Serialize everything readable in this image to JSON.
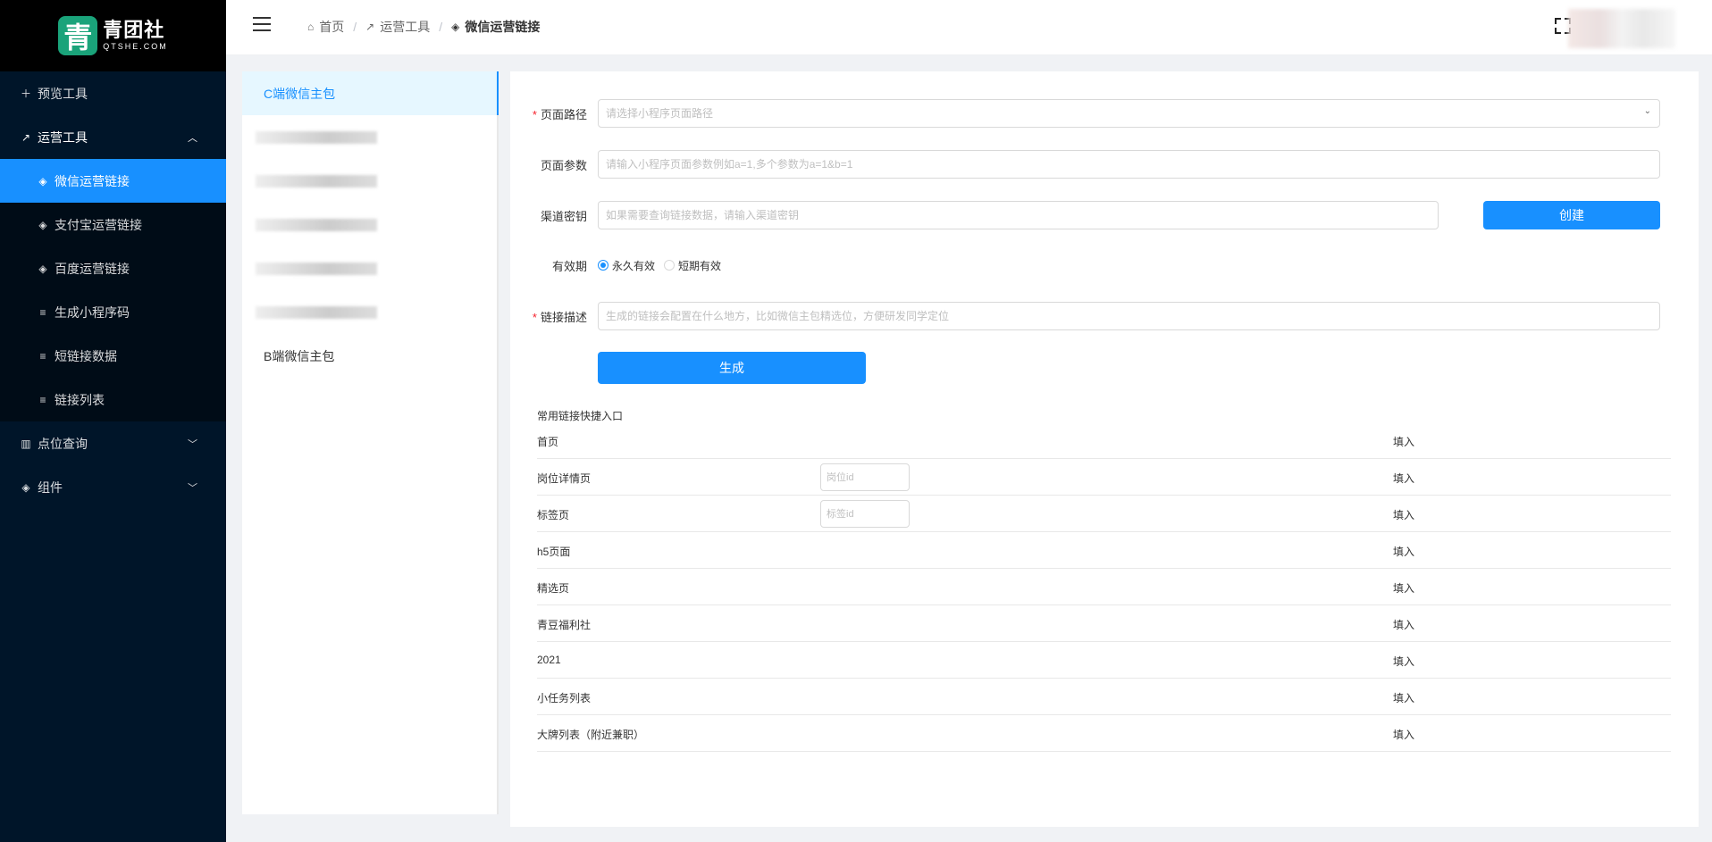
{
  "logo": {
    "glyph": "青",
    "name": "青团社",
    "domain": "QTSHE.COM"
  },
  "sidebar": {
    "items": [
      {
        "label": "预览工具",
        "icon": "plus-icon"
      },
      {
        "label": "运营工具",
        "icon": "tool-icon",
        "expanded": true
      },
      {
        "label": "微信运营链接",
        "icon": "layers-icon",
        "active": true
      },
      {
        "label": "支付宝运营链接",
        "icon": "layers-icon"
      },
      {
        "label": "百度运营链接",
        "icon": "layers-icon"
      },
      {
        "label": "生成小程序码",
        "icon": "filter-icon"
      },
      {
        "label": "短链接数据",
        "icon": "filter-icon"
      },
      {
        "label": "链接列表",
        "icon": "filter-icon"
      },
      {
        "label": "点位查询",
        "icon": "bar-chart-icon"
      },
      {
        "label": "组件",
        "icon": "layers-icon"
      }
    ]
  },
  "header": {
    "breadcrumb": [
      {
        "label": "首页",
        "icon": "home-icon"
      },
      {
        "label": "运营工具",
        "icon": "tool-icon"
      },
      {
        "label": "微信运营链接",
        "icon": "layers-icon"
      }
    ]
  },
  "tabs": {
    "first": "C端微信主包",
    "last": "B端微信主包"
  },
  "form": {
    "path_label": "页面路径",
    "path_placeholder": "请选择小程序页面路径",
    "params_label": "页面参数",
    "params_placeholder": "请输入小程序页面参数例如a=1,多个参数为a=1&b=1",
    "channel_label": "渠道密钥",
    "channel_placeholder": "如果需要查询链接数据，请输入渠道密钥",
    "create_label": "创建",
    "validity_label": "有效期",
    "validity_options": [
      "永久有效",
      "短期有效"
    ],
    "validity_selected": "永久有效",
    "desc_label": "链接描述",
    "desc_placeholder": "生成的链接会配置在什么地方，比如微信主包精选位，方便研发同学定位",
    "generate_label": "生成"
  },
  "quick": {
    "title": "常用链接快捷入口",
    "fill_label": "填入",
    "rows": [
      {
        "name": "首页"
      },
      {
        "name": "岗位详情页",
        "placeholder": "岗位id"
      },
      {
        "name": "标签页",
        "placeholder": "标签id"
      },
      {
        "name": "h5页面"
      },
      {
        "name": "精选页"
      },
      {
        "name": "青豆福利社"
      },
      {
        "name": "2021"
      },
      {
        "name": "小任务列表"
      },
      {
        "name": "大牌列表（附近兼职）"
      }
    ]
  },
  "colors": {
    "primary": "#1890ff",
    "sidebar": "#001529",
    "required": "#f5222d"
  }
}
